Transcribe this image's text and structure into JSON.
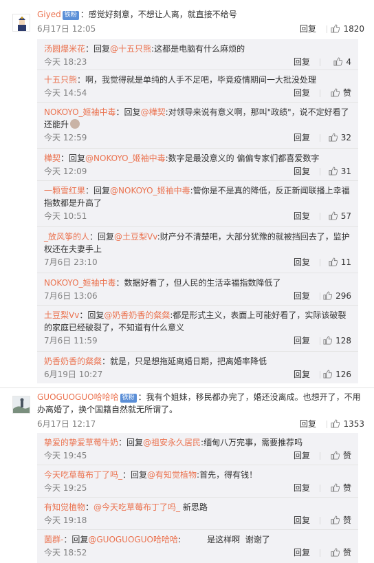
{
  "thread1": {
    "user": "Giyed",
    "badge": "铁粉",
    "text": "：感觉好刻意，不想让人离，就直接不给号",
    "time": "6月17日 12:05",
    "reply": "回复",
    "likes": "1820",
    "replies": [
      {
        "user": "汤圆爆米花",
        "pre": "：回复",
        "mention": "@十五只熊",
        "body": ":这都是电脑有什么麻烦的",
        "time": "今天 18:23",
        "reply": "回复",
        "likes": "4"
      },
      {
        "user": "十五只熊",
        "pre": "：啊，我觉得就是单纯的人手不足吧，毕竟疫情期间一大批没处理",
        "mention": "",
        "body": "",
        "time": "今天 14:54",
        "reply": "回复",
        "likes": "赞"
      },
      {
        "user": "NOKOYO_姬袖中毒",
        "pre": "：回复",
        "mention": "@樺契",
        "body": ":对领导来说有意义啊，那叫\"政绩\"，说不定好看了还能升",
        "time": "今天 12:59",
        "reply": "回复",
        "likes": "32"
      },
      {
        "user": "樺契",
        "pre": "：回复",
        "mention": "@NOKOYO_姬袖中毒",
        "body": ":数字是最没意义的  偏偏专家们都喜爱数字",
        "time": "今天 12:09",
        "reply": "回复",
        "likes": "31"
      },
      {
        "user": "一颗雪红果",
        "pre": "：回复",
        "mention": "@NOKOYO_姬袖中毒",
        "body": ":管你是不是真的降低，反正新闻联播上幸福指数都是升高了",
        "time": "今天 10:51",
        "reply": "回复",
        "likes": "57"
      },
      {
        "user": "_放风筝的人",
        "pre": "：回复",
        "mention": "@土豆梨Vv",
        "body": ":财产分不清楚吧，大部分犹豫的就被挡回去了，监护权还在夫妻手上",
        "time": "7月6日 23:10",
        "reply": "回复",
        "likes": "11"
      },
      {
        "user": "NOKOYO_姬袖中毒",
        "pre": "：数据好看了，但人民的生活幸福指数降低了",
        "mention": "",
        "body": "",
        "time": "7月6日 13:06",
        "reply": "回复",
        "likes": "296"
      },
      {
        "user": "土豆梨Vv",
        "pre": "：回复",
        "mention": "@奶香奶香的粲粲",
        "body": ":都是形式主义，表面上可能好看了，实际该破裂的家庭已经破裂了，不知道有什么意义",
        "time": "7月6日 11:59",
        "reply": "回复",
        "likes": "128"
      },
      {
        "user": "奶香奶香的粲粲",
        "pre": "：就是，只是想拖延离婚日期，把离婚率降低",
        "mention": "",
        "body": "",
        "time": "6月19日 10:27",
        "reply": "回复",
        "likes": "126"
      }
    ]
  },
  "thread2": {
    "user": "GUOGUOGUO哈哈哈",
    "badge": "铁粉",
    "text": "：我有个姐妹，移民都办完了，婚还没离成。也想开了，不用办离婚了，换个国籍自然就无所谓了。",
    "time": "6月17日 12:17",
    "reply": "回复",
    "likes": "1353",
    "replies": [
      {
        "user": "挚爱的挚爱草莓牛奶",
        "pre": "：回复",
        "mention": "@祖安永久居民",
        "body": ":缅甸八万完事，需要推荐吗",
        "time": "今天 19:45",
        "reply": "回复",
        "likes": "赞"
      },
      {
        "user": "今天吃草莓布丁了吗_",
        "pre": "：回复",
        "mention": "@有知觉植物",
        "body": ":首先，得有钱！",
        "time": "今天 19:25",
        "reply": "回复",
        "likes": "赞"
      },
      {
        "user": "有知觉植物",
        "pre": "：",
        "mention": "@今天吃草莓布丁了吗_",
        "body": " 新思路",
        "time": "今天 19:18",
        "reply": "回复",
        "likes": "赞"
      },
      {
        "user": "菌群-",
        "pre": "：回复",
        "mention": "@GUOGUOGUO哈哈哈",
        "body": ":          是这样啊  谢谢了",
        "time": "今天 18:52",
        "reply": "回复",
        "likes": "赞"
      }
    ]
  }
}
